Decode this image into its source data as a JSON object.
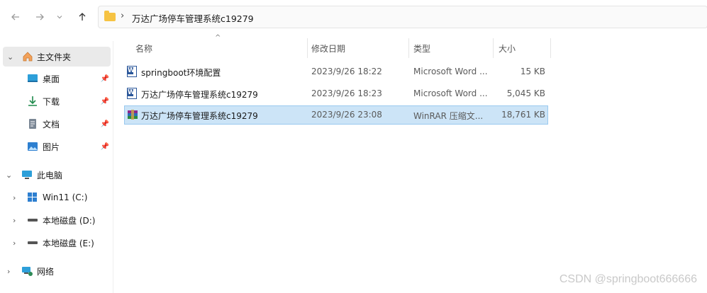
{
  "nav": {
    "back_icon": "arrow-left-icon",
    "forward_icon": "arrow-right-icon",
    "recent_icon": "chevron-down-icon",
    "up_icon": "arrow-up-icon",
    "address_path": "万达广场停车管理系统c19279"
  },
  "sidebar": {
    "quick_access": {
      "label": "主文件夹"
    },
    "pinned": [
      {
        "label": "桌面",
        "icon": "desktop-icon"
      },
      {
        "label": "下载",
        "icon": "download-icon"
      },
      {
        "label": "文档",
        "icon": "document-icon"
      },
      {
        "label": "图片",
        "icon": "picture-icon"
      }
    ],
    "this_pc": {
      "label": "此电脑"
    },
    "drives": [
      {
        "label": "Win11 (C:)"
      },
      {
        "label": "本地磁盘 (D:)"
      },
      {
        "label": "本地磁盘 (E:)"
      }
    ],
    "network": {
      "label": "网络"
    }
  },
  "columns": {
    "name": "名称",
    "modified": "修改日期",
    "type": "类型",
    "size": "大小"
  },
  "files": [
    {
      "name": "springboot环境配置",
      "modified": "2023/9/26 18:22",
      "type": "Microsoft Word ...",
      "size": "15 KB",
      "icon": "word-document-icon"
    },
    {
      "name": "万达广场停车管理系统c19279",
      "modified": "2023/9/26 18:23",
      "type": "Microsoft Word ...",
      "size": "5,045 KB",
      "icon": "word-document-icon"
    },
    {
      "name": "万达广场停车管理系统c19279",
      "modified": "2023/9/26 23:08",
      "type": "WinRAR 压缩文...",
      "size": "18,761 KB",
      "icon": "winrar-archive-icon",
      "selected": true
    }
  ],
  "watermark": "CSDN @springboot666666",
  "colors": {
    "selection": "#cce4f7",
    "selection_border": "#99c9ef",
    "folder": "#f6c343",
    "word": "#2b579a"
  }
}
